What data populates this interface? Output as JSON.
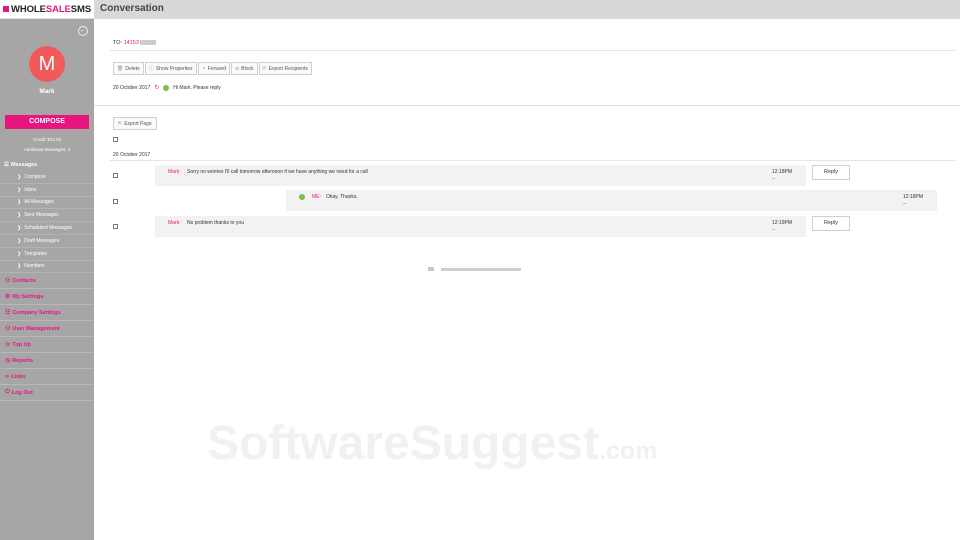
{
  "app": {
    "logo_part1": "WHOLE",
    "logo_part2": "SALE",
    "logo_part3": "SMS"
  },
  "header": {
    "title": "Conversation"
  },
  "sidebar": {
    "collapse_icon": "back-arrow-icon",
    "avatar_letter": "M",
    "user_name": "Mark",
    "compose_label": "COMPOSE",
    "credit": "Credit: $10.00",
    "additional_messages": "Additional Messages: 3",
    "messages_section": "Messages",
    "message_items": [
      "Compose",
      "Inbox",
      "All Messages",
      "Sent Messages",
      "Scheduled Messages",
      "Draft Messages",
      "Templates",
      "Numbers"
    ],
    "nav_items": [
      {
        "label": "Contacts",
        "icon": "person-icon",
        "glyph": "⚇"
      },
      {
        "label": "My Settings",
        "icon": "gear-icon",
        "glyph": "⚙"
      },
      {
        "label": "Company Settings",
        "icon": "sliders-icon",
        "glyph": "☷"
      },
      {
        "label": "User Management",
        "icon": "users-icon",
        "glyph": "⚇"
      },
      {
        "label": "Top Up",
        "icon": "star-icon",
        "glyph": "☆"
      },
      {
        "label": "Reports",
        "icon": "chart-icon",
        "glyph": "◷"
      },
      {
        "label": "Links",
        "icon": "link-icon",
        "glyph": "∞"
      },
      {
        "label": "Log Out",
        "icon": "power-icon",
        "glyph": "⏻"
      }
    ]
  },
  "conversation": {
    "to_label": "TO:",
    "to_number": "14153",
    "toolbar": {
      "delete": "Delete",
      "show_properties": "Show Properties",
      "forward": "Forward",
      "block": "Block",
      "export_recipients": "Export Recipients"
    },
    "header_date": "20 October 2017",
    "header_message": "Hi Mark. Please reply",
    "export_page": "Export Page",
    "day_label": "20 October 2017",
    "messages": [
      {
        "sender": "Mark:",
        "text": "Sorry no worries I'll call tomorrow afternoon if we have anything we need for a call",
        "time": "12:18PM",
        "status": "--",
        "reply": "Reply"
      },
      {
        "sender": "ME:",
        "text": "Okay. Thanks.",
        "time": "12:18PM",
        "status": "--"
      },
      {
        "sender": "Mark:",
        "text": "No problem thanks to you",
        "time": "12:19PM",
        "status": "--",
        "reply": "Reply"
      }
    ]
  },
  "watermark": {
    "main": "SoftwareSuggest",
    "suffix": ".com"
  },
  "colors": {
    "accent": "#e8157f",
    "sidebar": "#a6a6a6",
    "avatar": "#f05a5a",
    "me_dot": "#7cbd4f"
  }
}
